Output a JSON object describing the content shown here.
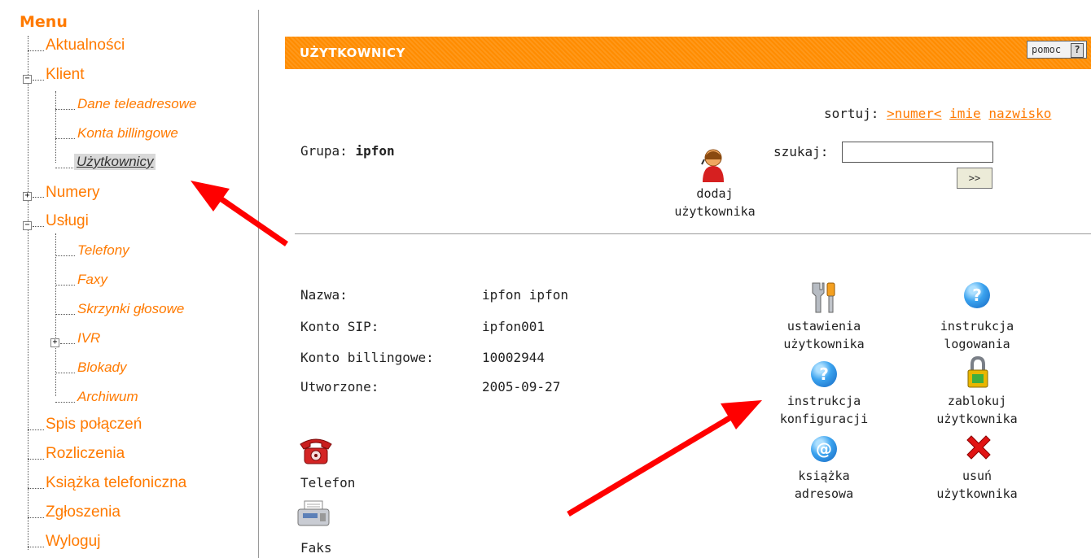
{
  "menu": {
    "title": "Menu",
    "items": {
      "aktualnosci": "Aktualności",
      "klient": "Klient",
      "dane": "Dane teleadresowe",
      "konta": "Konta billingowe",
      "uzytkownicy": "Użytkownicy",
      "numery": "Numery",
      "uslugi": "Usługi",
      "telefony": "Telefony",
      "faxy": "Faxy",
      "skrzynki": "Skrzynki głosowe",
      "ivr": "IVR",
      "blokady": "Blokady",
      "archiwum": "Archiwum",
      "spis": "Spis połączeń",
      "rozliczenia": "Rozliczenia",
      "ksiazka": "Książka telefoniczna",
      "zgloszenia": "Zgłoszenia",
      "wyloguj": "Wyloguj"
    },
    "toggles": {
      "minus": "−",
      "plus": "+"
    }
  },
  "header": {
    "title": "UŻYTKOWNICY",
    "help_label": "pomoc",
    "help_icon": "?"
  },
  "sort": {
    "label": "sortuj:",
    "numer": ">numer<",
    "imie": "imie",
    "nazwisko": "nazwisko"
  },
  "group": {
    "label": "Grupa:",
    "value": "ipfon"
  },
  "search": {
    "label": "szukaj:",
    "value": "",
    "button": ">>"
  },
  "add_user": {
    "line1": "dodaj",
    "line2": "użytkownika",
    "icon": "user-add-icon"
  },
  "details": [
    {
      "label": "Nazwa:",
      "value": "ipfon ipfon"
    },
    {
      "label": "Konto SIP:",
      "value": "ipfon001"
    },
    {
      "label": "Konto billingowe:",
      "value": "10002944"
    },
    {
      "label": "Utworzone:",
      "value": "2005-09-27"
    }
  ],
  "services": {
    "phone": "Telefon",
    "fax": "Faks"
  },
  "actions": {
    "settings": {
      "line1": "ustawienia",
      "line2": "użytkownika",
      "icon": "tools-icon"
    },
    "login_help": {
      "line1": "instrukcja",
      "line2": "logowania",
      "icon": "help-icon",
      "glyph": "?"
    },
    "config_help": {
      "line1": "instrukcja",
      "line2": "konfiguracji",
      "icon": "help-icon",
      "glyph": "?"
    },
    "lock": {
      "line1": "zablokuj",
      "line2": "użytkownika",
      "icon": "padlock-icon"
    },
    "addressbook": {
      "line1": "książka",
      "line2": "adresowa",
      "icon": "at-icon",
      "glyph": "@"
    },
    "delete": {
      "line1": "usuń",
      "line2": "użytkownika",
      "icon": "red-x-icon"
    }
  },
  "colors": {
    "accent": "#ff7a00",
    "header_bg": "#ff8c00",
    "annotation": "#ff0000"
  }
}
